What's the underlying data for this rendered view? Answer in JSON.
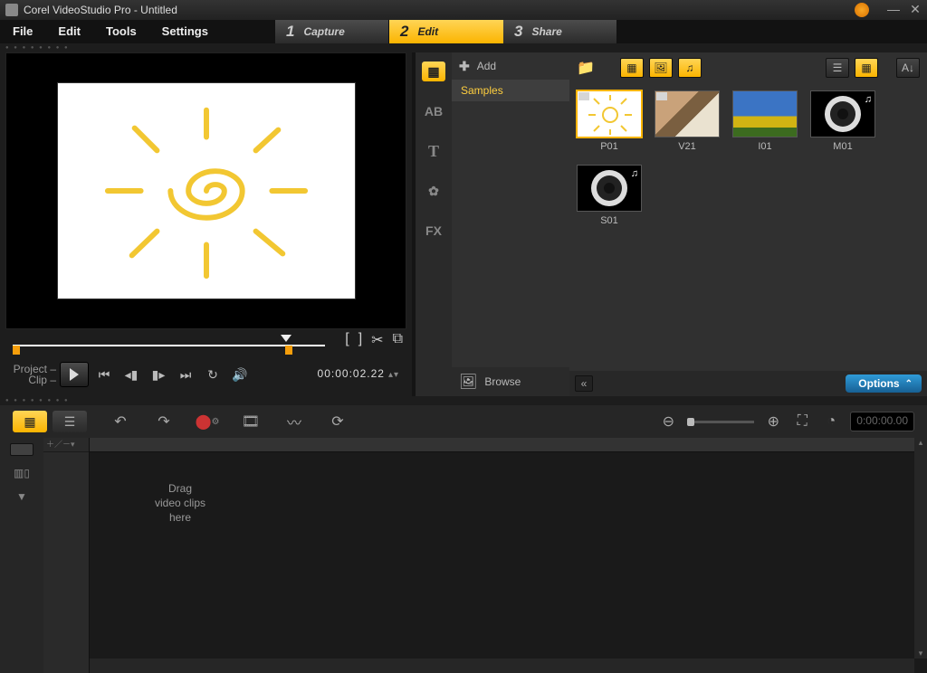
{
  "window": {
    "title": "Corel VideoStudio Pro - Untitled"
  },
  "menu": {
    "file": "File",
    "edit": "Edit",
    "tools": "Tools",
    "settings": "Settings"
  },
  "steps": [
    {
      "num": "1",
      "label": "Capture"
    },
    {
      "num": "2",
      "label": "Edit"
    },
    {
      "num": "3",
      "label": "Share"
    }
  ],
  "active_step": 1,
  "preview": {
    "project_label": "Project",
    "clip_label": "Clip",
    "timecode": "00:00:02.22"
  },
  "library": {
    "add_label": "Add",
    "folders": [
      "Samples"
    ],
    "selected_folder": 0,
    "browse_label": "Browse",
    "options_label": "Options",
    "side_tabs": [
      "media",
      "transition",
      "title",
      "graphic",
      "fx"
    ],
    "thumbs": [
      {
        "label": "P01",
        "kind": "project",
        "selected": true
      },
      {
        "label": "V21",
        "kind": "video"
      },
      {
        "label": "I01",
        "kind": "image"
      },
      {
        "label": "M01",
        "kind": "audio"
      },
      {
        "label": "S01",
        "kind": "audio"
      }
    ]
  },
  "timeline": {
    "timecode_html": "0:00:00.00",
    "drop_hint": "Drag\nvideo clips\nhere"
  }
}
